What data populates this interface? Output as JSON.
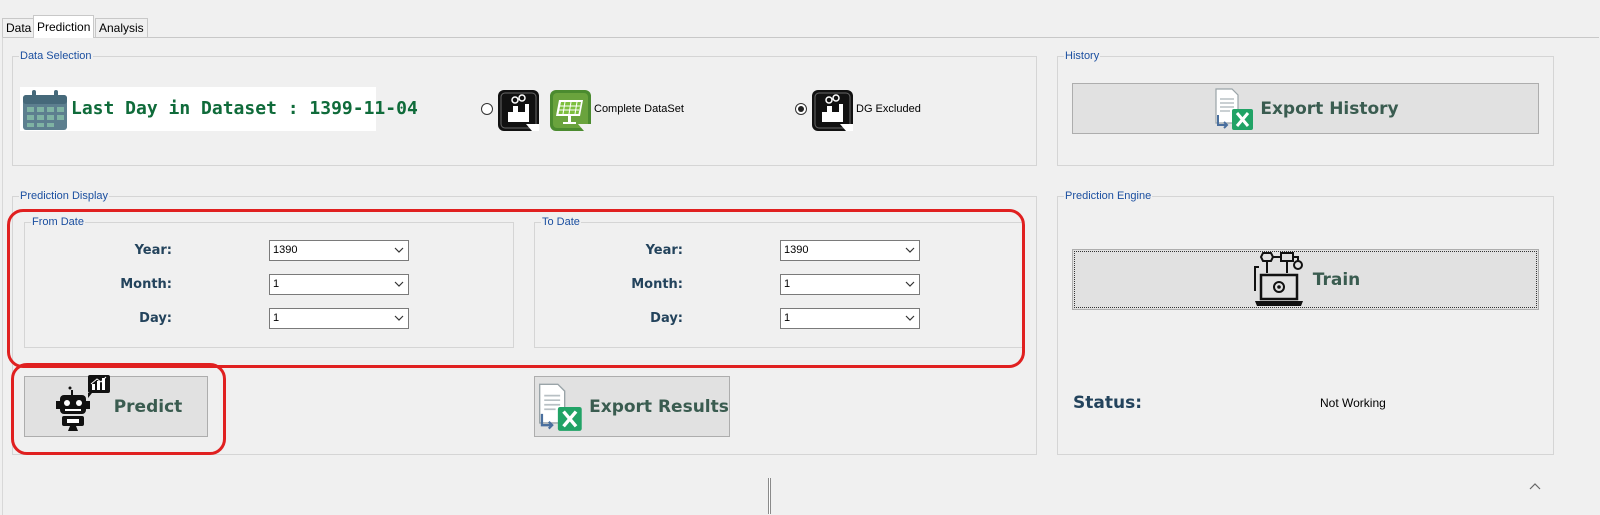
{
  "tabs": [
    {
      "label": "Data"
    },
    {
      "label": "Prediction"
    },
    {
      "label": "Analysis"
    }
  ],
  "data_selection": {
    "title": "Data Selection",
    "last_day_label": "Last Day in Dataset : 1399-11-04",
    "options": [
      {
        "label": "Complete DataSet",
        "checked": false
      },
      {
        "label": "DG Excluded",
        "checked": true
      }
    ]
  },
  "history": {
    "title": "History",
    "export_label": "Export History"
  },
  "prediction_display": {
    "title": "Prediction Display",
    "from": {
      "title": "From Date",
      "year_label": "Year:",
      "year_value": "1390",
      "month_label": "Month:",
      "month_value": "1",
      "day_label": "Day:",
      "day_value": "1"
    },
    "to": {
      "title": "To Date",
      "year_label": "Year:",
      "year_value": "1390",
      "month_label": "Month:",
      "month_value": "1",
      "day_label": "Day:",
      "day_value": "1"
    },
    "predict_label": "Predict",
    "export_results_label": "Export Results"
  },
  "engine": {
    "title": "Prediction Engine",
    "train_label": "Train",
    "status_label": "Status:",
    "status_value": "Not Working"
  },
  "colors": {
    "highlight": "#e02020",
    "group_title": "#1b4fa0",
    "excel_green": "#21a366"
  }
}
